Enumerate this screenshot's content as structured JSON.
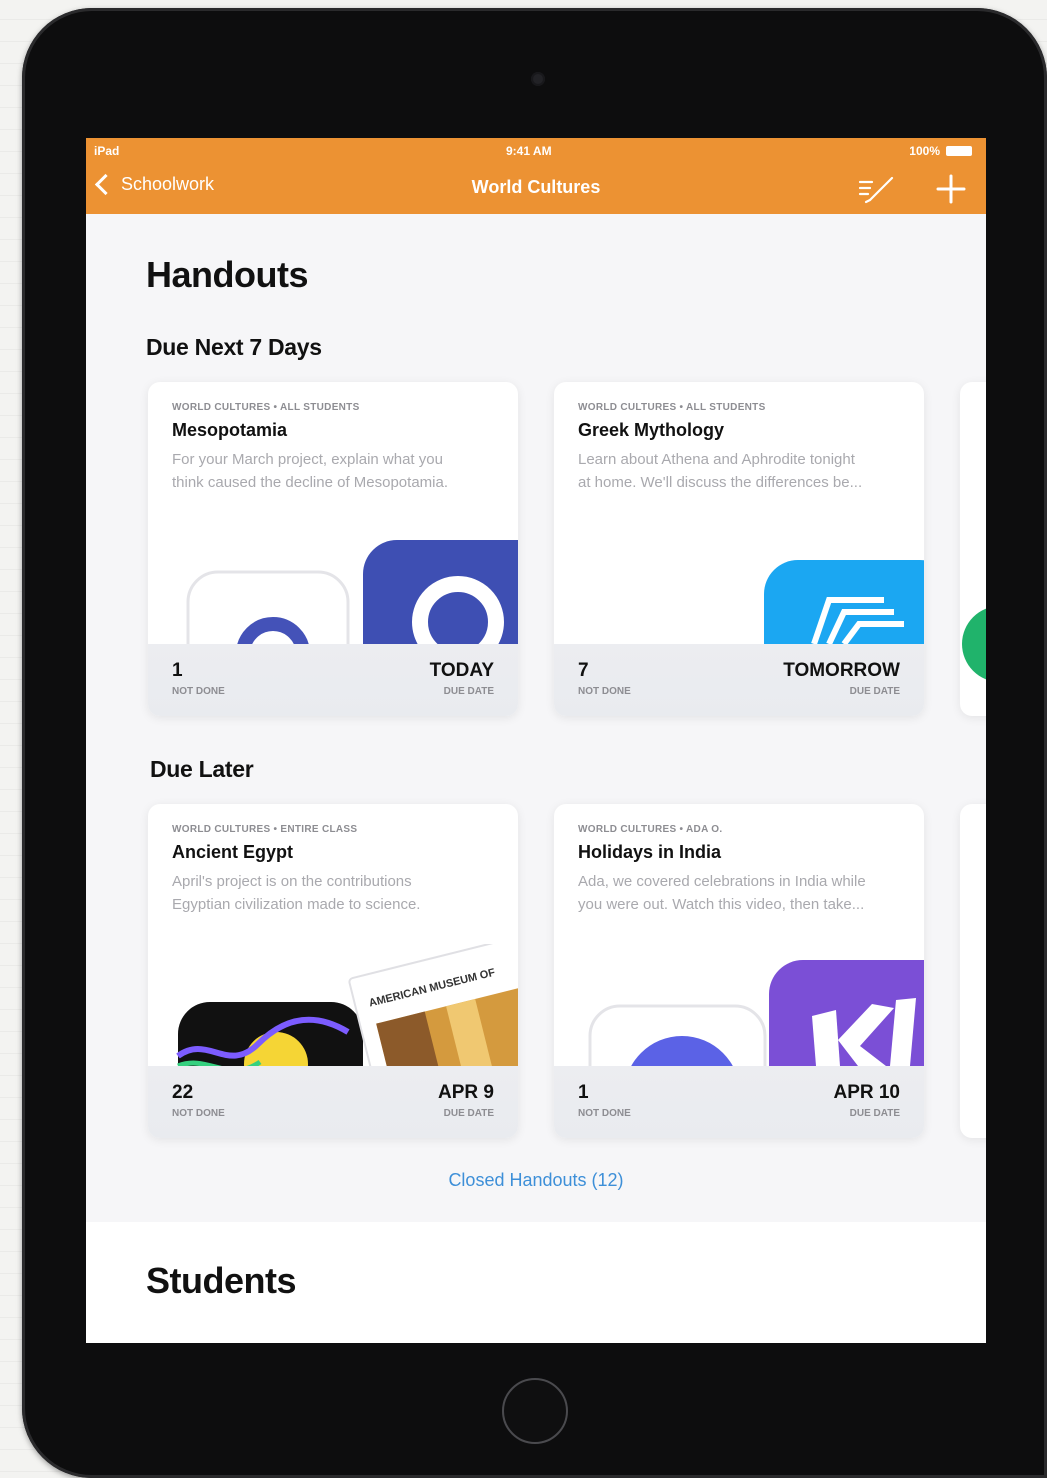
{
  "status_bar": {
    "left": "iPad",
    "time": "9:41 AM",
    "battery": "100%"
  },
  "nav": {
    "back_label": "Schoolwork",
    "title": "World Cultures"
  },
  "handouts": {
    "title": "Handouts",
    "sections": [
      {
        "heading": "Due Next 7 Days",
        "cards": [
          {
            "class_label": "WORLD CULTURES • ALL STUDENTS",
            "title": "Mesopotamia",
            "description": "For your March project, explain what you think caused the decline of Mesopotamia.",
            "count": "1",
            "count_label": "NOT DONE",
            "due": "TODAY",
            "due_label": "DUE DATE"
          },
          {
            "class_label": "WORLD CULTURES • ALL STUDENTS",
            "title": "Greek Mythology",
            "description": "Learn about Athena and Aphrodite tonight at home. We'll discuss the differences be...",
            "count": "7",
            "count_label": "NOT DONE",
            "due": "TOMORROW",
            "due_label": "DUE DATE"
          }
        ]
      },
      {
        "heading": "Due Later",
        "cards": [
          {
            "class_label": "WORLD CULTURES • ENTIRE CLASS",
            "title": "Ancient Egypt",
            "description": "April's project is on the contributions Egyptian civilization made to science.",
            "count": "22",
            "count_label": "NOT DONE",
            "due": "APR 9",
            "due_label": "DUE DATE",
            "art_text": "AMERICAN MUSEUM OF"
          },
          {
            "class_label": "WORLD CULTURES • ADA O.",
            "title": "Holidays in India",
            "description": "Ada, we covered celebrations in India while you were out. Watch this video, then take...",
            "count": "1",
            "count_label": "NOT DONE",
            "due": "APR 10",
            "due_label": "DUE DATE"
          }
        ]
      }
    ],
    "closed_link": "Closed Handouts (12)"
  },
  "students": {
    "title": "Students"
  },
  "colors": {
    "nav_orange": "#ec9233",
    "link_blue": "#3d8fd8",
    "card_icon_blue": "#3e4fb3",
    "card_icon_cyan": "#1ba7f2",
    "card_icon_purple": "#7b4fd6",
    "card_icon_green": "#20b36b"
  }
}
